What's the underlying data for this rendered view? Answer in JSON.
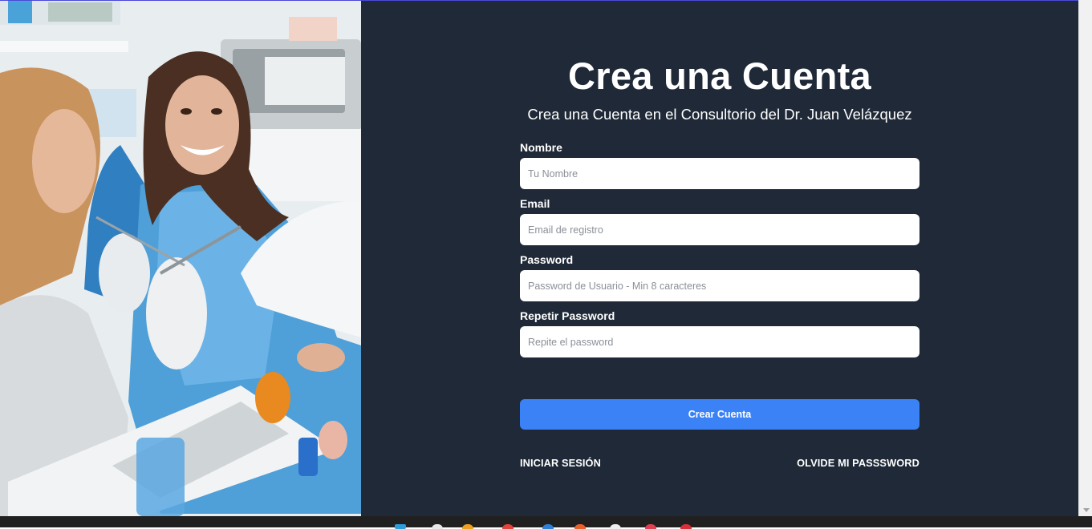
{
  "form": {
    "title": "Crea una Cuenta",
    "subtitle": "Crea una Cuenta en el Consultorio del Dr. Juan Velázquez",
    "fields": [
      {
        "label": "Nombre",
        "placeholder": "Tu Nombre",
        "value": ""
      },
      {
        "label": "Email",
        "placeholder": "Email de registro",
        "value": ""
      },
      {
        "label": "Password",
        "placeholder": "Password de Usuario - Min 8 caracteres",
        "value": ""
      },
      {
        "label": "Repetir Password",
        "placeholder": "Repite el password",
        "value": ""
      }
    ],
    "submit_label": "Crear Cuenta"
  },
  "links": {
    "login": "INICIAR SESIÓN",
    "forgot": "OLVIDE MI PASSSWORD"
  },
  "colors": {
    "panel_bg": "#1f2937",
    "button_bg": "#3b82f6",
    "text": "#ffffff"
  },
  "hero": {
    "icon": "dental-clinic-photo"
  }
}
